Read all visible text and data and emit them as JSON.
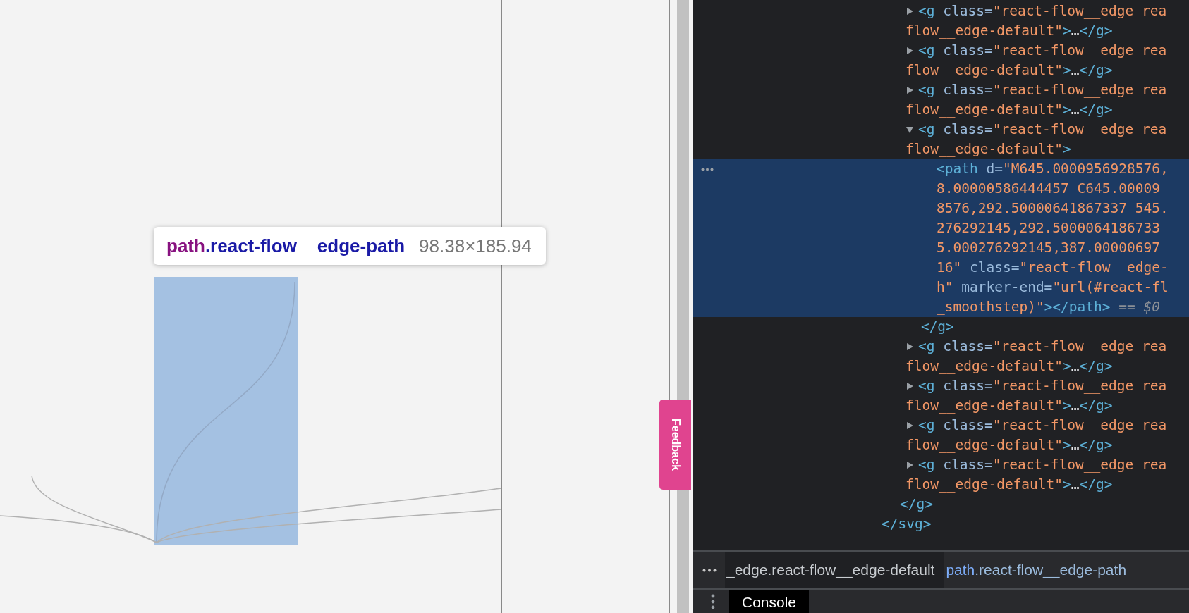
{
  "canvas": {
    "tooltip": {
      "tag": "path",
      "selector": ".react-flow__edge-path",
      "size": "98.38×185.94"
    },
    "feedback_button": "Feedback"
  },
  "elements_tree": [
    {
      "close": [
        {
          "kind": "tag",
          "text": "</svg>"
        }
      ],
      "children": [
        {
          "close": [
            {
              "kind": "tag",
              "text": "</g>"
            }
          ],
          "children": [
            {
              "expanded": false,
              "selected": false,
              "lines": [
                [
                  {
                    "kind": "tag",
                    "text": "<g"
                  },
                  {
                    "kind": "attr",
                    "text": " class="
                  },
                  {
                    "kind": "value",
                    "text": "\"react-flow__edge rea"
                  }
                ],
                [
                  {
                    "kind": "value",
                    "text": "flow__edge-default\""
                  },
                  {
                    "kind": "tag",
                    "text": ">"
                  },
                  {
                    "kind": "plain",
                    "text": "…"
                  },
                  {
                    "kind": "tag",
                    "text": "</g>"
                  }
                ]
              ]
            },
            {
              "expanded": false,
              "selected": false,
              "lines": [
                [
                  {
                    "kind": "tag",
                    "text": "<g"
                  },
                  {
                    "kind": "attr",
                    "text": " class="
                  },
                  {
                    "kind": "value",
                    "text": "\"react-flow__edge rea"
                  }
                ],
                [
                  {
                    "kind": "value",
                    "text": "flow__edge-default\""
                  },
                  {
                    "kind": "tag",
                    "text": ">"
                  },
                  {
                    "kind": "plain",
                    "text": "…"
                  },
                  {
                    "kind": "tag",
                    "text": "</g>"
                  }
                ]
              ]
            },
            {
              "expanded": false,
              "selected": false,
              "lines": [
                [
                  {
                    "kind": "tag",
                    "text": "<g"
                  },
                  {
                    "kind": "attr",
                    "text": " class="
                  },
                  {
                    "kind": "value",
                    "text": "\"react-flow__edge rea"
                  }
                ],
                [
                  {
                    "kind": "value",
                    "text": "flow__edge-default\""
                  },
                  {
                    "kind": "tag",
                    "text": ">"
                  },
                  {
                    "kind": "plain",
                    "text": "…"
                  },
                  {
                    "kind": "tag",
                    "text": "</g>"
                  }
                ]
              ]
            },
            {
              "expanded": true,
              "selected": false,
              "lines": [
                [
                  {
                    "kind": "tag",
                    "text": "<g"
                  },
                  {
                    "kind": "attr",
                    "text": " class="
                  },
                  {
                    "kind": "value",
                    "text": "\"react-flow__edge rea"
                  }
                ],
                [
                  {
                    "kind": "value",
                    "text": "flow__edge-default\""
                  },
                  {
                    "kind": "tag",
                    "text": ">"
                  }
                ]
              ],
              "close": [
                {
                  "kind": "tag",
                  "text": "</g>"
                }
              ],
              "children": [
                {
                  "selected": true,
                  "lines": [
                    [
                      {
                        "kind": "tag",
                        "text": "<path"
                      },
                      {
                        "kind": "attr",
                        "text": " d="
                      },
                      {
                        "kind": "value",
                        "text": "\"M645.0000956928576,"
                      }
                    ],
                    [
                      {
                        "kind": "value",
                        "text": "8.00000586444457 C645.00009"
                      }
                    ],
                    [
                      {
                        "kind": "value",
                        "text": "8576,292.50000641867337 545."
                      }
                    ],
                    [
                      {
                        "kind": "value",
                        "text": "276292145,292.5000064186733"
                      }
                    ],
                    [
                      {
                        "kind": "value",
                        "text": "5.000276292145,387.00000697"
                      }
                    ],
                    [
                      {
                        "kind": "value",
                        "text": "16\""
                      },
                      {
                        "kind": "attr",
                        "text": " class="
                      },
                      {
                        "kind": "value",
                        "text": "\"react-flow__edge-"
                      }
                    ],
                    [
                      {
                        "kind": "value",
                        "text": "h\""
                      },
                      {
                        "kind": "attr",
                        "text": " marker-end="
                      },
                      {
                        "kind": "value",
                        "text": "\"url(#react-fl"
                      }
                    ],
                    [
                      {
                        "kind": "value",
                        "text": "_smoothstep)\""
                      },
                      {
                        "kind": "tag",
                        "text": "></path>"
                      },
                      {
                        "kind": "ref",
                        "text": " == $0"
                      }
                    ]
                  ]
                }
              ]
            },
            {
              "expanded": false,
              "selected": false,
              "lines": [
                [
                  {
                    "kind": "tag",
                    "text": "<g"
                  },
                  {
                    "kind": "attr",
                    "text": " class="
                  },
                  {
                    "kind": "value",
                    "text": "\"react-flow__edge rea"
                  }
                ],
                [
                  {
                    "kind": "value",
                    "text": "flow__edge-default\""
                  },
                  {
                    "kind": "tag",
                    "text": ">"
                  },
                  {
                    "kind": "plain",
                    "text": "…"
                  },
                  {
                    "kind": "tag",
                    "text": "</g>"
                  }
                ]
              ]
            },
            {
              "expanded": false,
              "selected": false,
              "lines": [
                [
                  {
                    "kind": "tag",
                    "text": "<g"
                  },
                  {
                    "kind": "attr",
                    "text": " class="
                  },
                  {
                    "kind": "value",
                    "text": "\"react-flow__edge rea"
                  }
                ],
                [
                  {
                    "kind": "value",
                    "text": "flow__edge-default\""
                  },
                  {
                    "kind": "tag",
                    "text": ">"
                  },
                  {
                    "kind": "plain",
                    "text": "…"
                  },
                  {
                    "kind": "tag",
                    "text": "</g>"
                  }
                ]
              ]
            },
            {
              "expanded": false,
              "selected": false,
              "lines": [
                [
                  {
                    "kind": "tag",
                    "text": "<g"
                  },
                  {
                    "kind": "attr",
                    "text": " class="
                  },
                  {
                    "kind": "value",
                    "text": "\"react-flow__edge rea"
                  }
                ],
                [
                  {
                    "kind": "value",
                    "text": "flow__edge-default\""
                  },
                  {
                    "kind": "tag",
                    "text": ">"
                  },
                  {
                    "kind": "plain",
                    "text": "…"
                  },
                  {
                    "kind": "tag",
                    "text": "</g>"
                  }
                ]
              ]
            },
            {
              "expanded": false,
              "selected": false,
              "lines": [
                [
                  {
                    "kind": "tag",
                    "text": "<g"
                  },
                  {
                    "kind": "attr",
                    "text": " class="
                  },
                  {
                    "kind": "value",
                    "text": "\"react-flow__edge rea"
                  }
                ],
                [
                  {
                    "kind": "value",
                    "text": "flow__edge-default\""
                  },
                  {
                    "kind": "tag",
                    "text": ">"
                  },
                  {
                    "kind": "plain",
                    "text": "…"
                  },
                  {
                    "kind": "tag",
                    "text": "</g>"
                  }
                ]
              ]
            }
          ]
        }
      ]
    }
  ],
  "breadcrumbs": [
    {
      "tag": "_edge",
      "classes": ".react-flow__edge-default",
      "selected": false
    },
    {
      "tag": "path",
      "classes": ".react-flow__edge-path",
      "selected": true
    }
  ],
  "drawer_tabs": [
    {
      "label": "Console",
      "selected": true
    }
  ]
}
